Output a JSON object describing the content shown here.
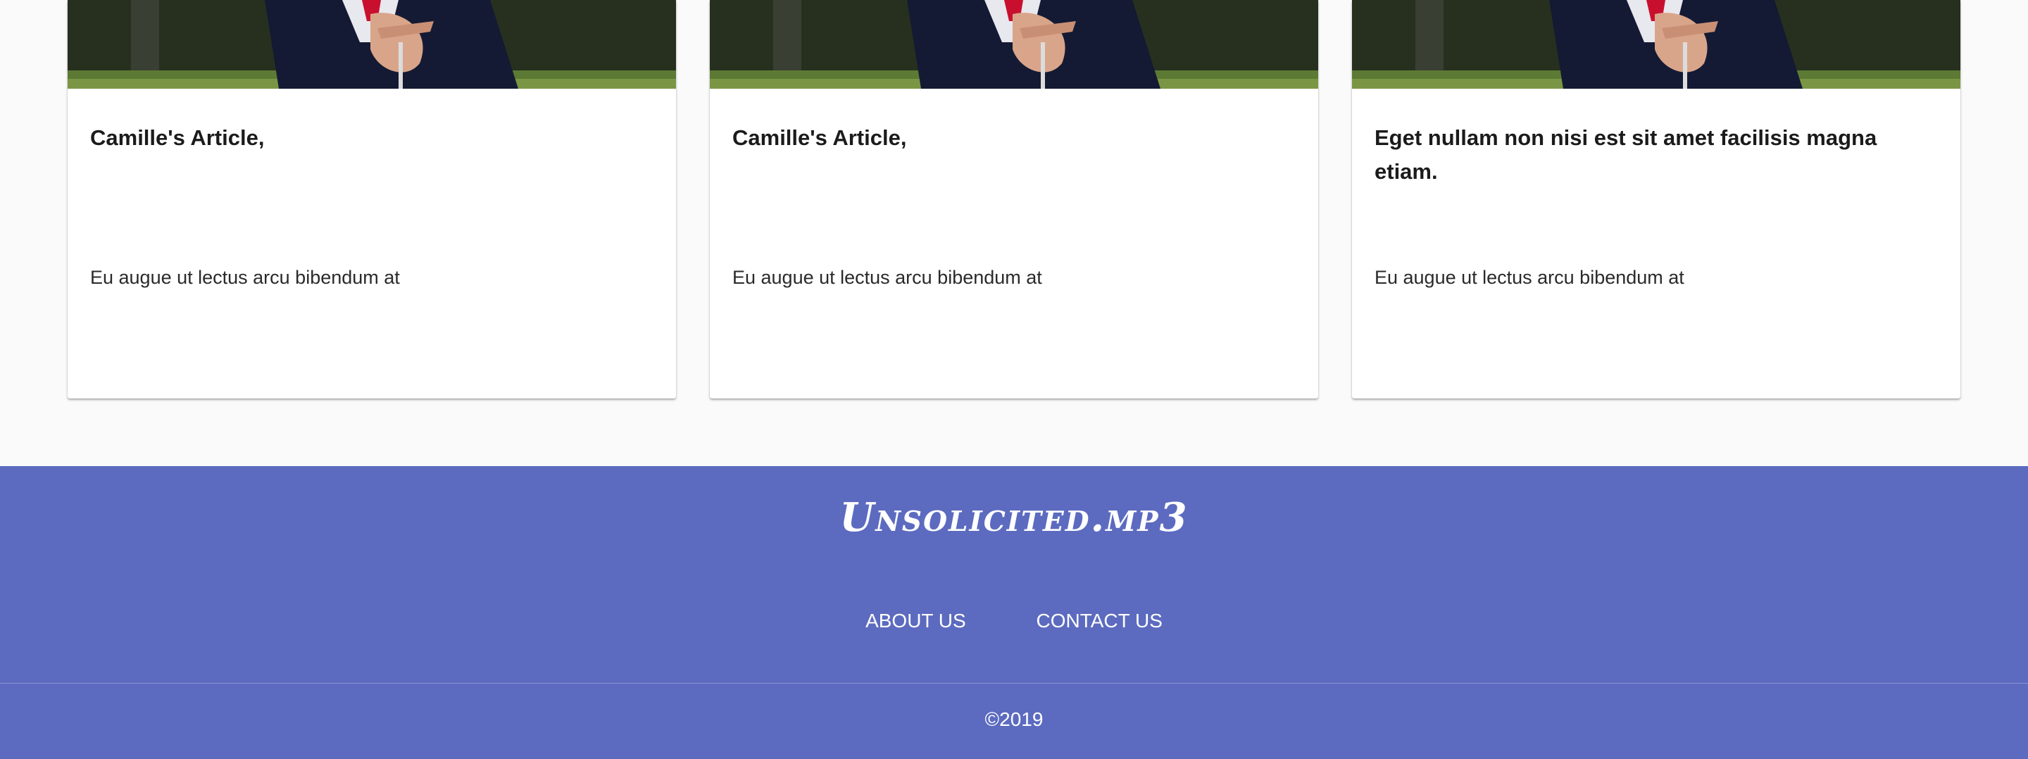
{
  "articles": [
    {
      "image_alt": "photo-of-man-in-suit",
      "title": "Camille's Article,",
      "excerpt": "Eu augue ut lectus arcu bibendum at"
    },
    {
      "image_alt": "photo-of-man-in-suit",
      "title": "Camille's Article,",
      "excerpt": "Eu augue ut lectus arcu bibendum at"
    },
    {
      "image_alt": "photo-of-man-in-suit",
      "title": "Eget nullam non nisi est sit amet facilisis magna etiam.",
      "excerpt": "Eu augue ut lectus arcu bibendum at"
    }
  ],
  "footer": {
    "brand": "Unsolicited.mp3",
    "links": [
      "ABOUT US",
      "CONTACT US"
    ],
    "copyright": "©2019"
  },
  "colors": {
    "footer_bg": "#5c6bc0",
    "page_bg": "#fafafa",
    "card_bg": "#ffffff"
  }
}
